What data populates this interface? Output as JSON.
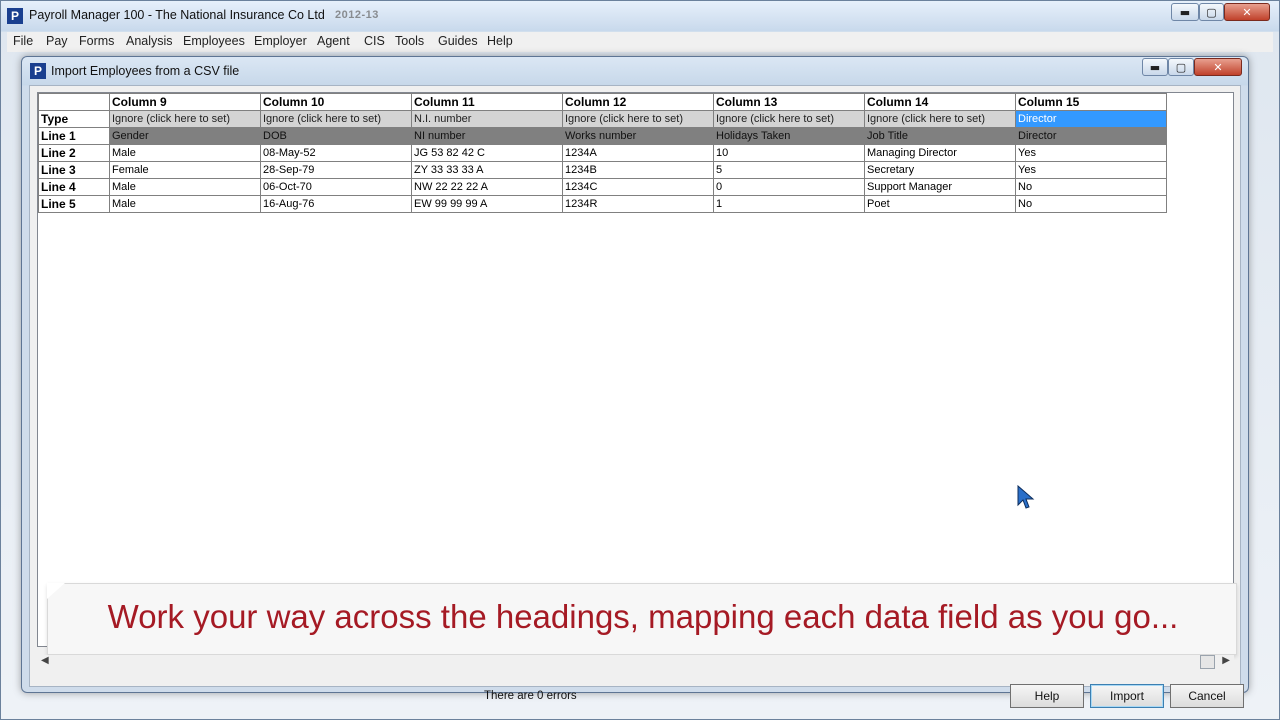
{
  "app": {
    "logo": "P",
    "title": "Payroll Manager 100  -  The National Insurance Co Ltd",
    "year": "2012-13",
    "min_glyph": "▬",
    "max_glyph": "▢",
    "close_glyph": "✕"
  },
  "menu": [
    "File",
    "Pay",
    "Forms",
    "Analysis",
    "Employees",
    "Employer",
    "Agent",
    "CIS",
    "Tools",
    "Guides",
    "Help"
  ],
  "dialog": {
    "logo": "P",
    "title": "Import Employees from a CSV file",
    "min_glyph": "▬",
    "max_glyph": "▢",
    "close_glyph": "✕"
  },
  "grid": {
    "columns": [
      "Column 9",
      "Column 10",
      "Column 11",
      "Column 12",
      "Column 13",
      "Column 14",
      "Column 15"
    ],
    "rows": [
      {
        "label": "Type",
        "cells": [
          "Ignore (click here to set)",
          "Ignore (click here to set)",
          "N.I. number",
          "Ignore (click here to set)",
          "Ignore (click here to set)",
          "Ignore (click here to set)",
          "Director"
        ]
      },
      {
        "label": "Line 1",
        "cells": [
          "Gender",
          "DOB",
          "NI number",
          "Works number",
          "Holidays Taken",
          "Job Title",
          "Director"
        ]
      },
      {
        "label": "Line 2",
        "cells": [
          "Male",
          "08-May-52",
          "JG 53 82 42 C",
          "1234A",
          "10",
          "Managing Director",
          "Yes"
        ]
      },
      {
        "label": "Line 3",
        "cells": [
          "Female",
          "28-Sep-79",
          "ZY 33 33 33 A",
          "1234B",
          "5",
          "Secretary",
          "Yes"
        ]
      },
      {
        "label": "Line 4",
        "cells": [
          "Male",
          "06-Oct-70",
          "NW 22 22 22 A",
          "1234C",
          "0",
          "Support Manager",
          "No"
        ]
      },
      {
        "label": "Line 5",
        "cells": [
          "Male",
          "16-Aug-76",
          "EW 99 99 99 A",
          "1234R",
          "1",
          "Poet",
          "No"
        ]
      }
    ],
    "selected_cell": "Type / Column 15"
  },
  "caption": "Work your way across the headings, mapping each data field as you go...",
  "scrollbar": {
    "left_arrow": "◀",
    "right_arrow": "▶"
  },
  "footer": {
    "errors": "There are 0 errors",
    "help": "Help",
    "import": "Import",
    "cancel": "Cancel"
  },
  "colors": {
    "type_row": "#d4d4d4",
    "line1_row": "#808080",
    "selected": "#3399ff",
    "caption_text": "#a51a24"
  }
}
